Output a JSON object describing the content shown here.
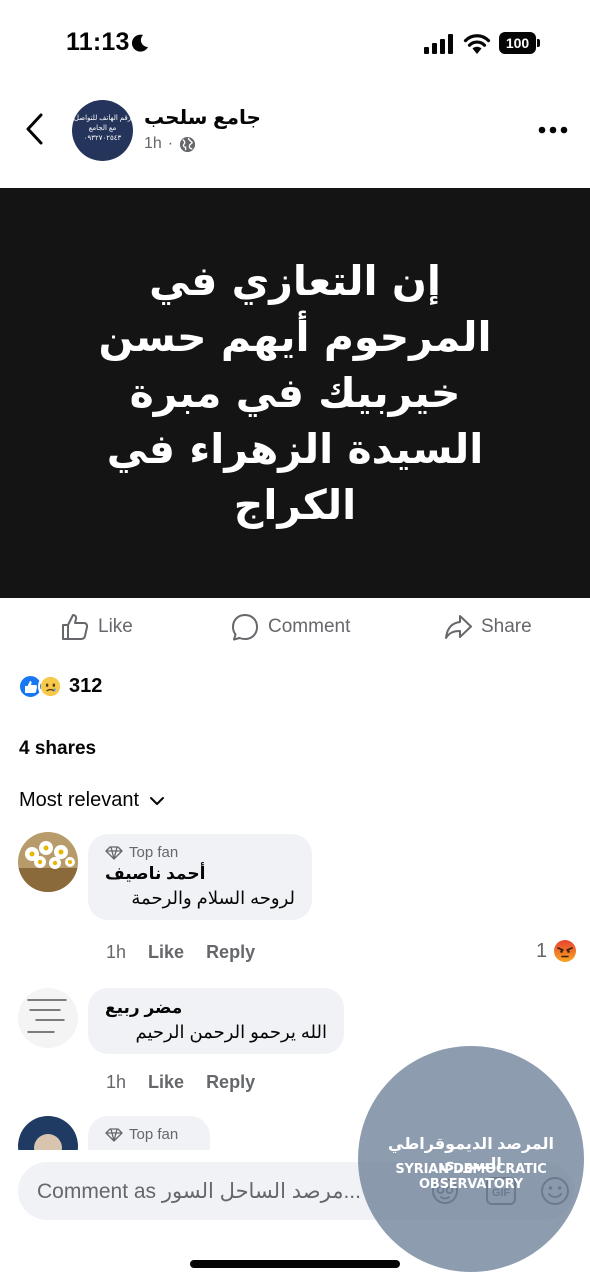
{
  "status_bar": {
    "time": "11:13",
    "battery": "100"
  },
  "post": {
    "page_name": "جامع سلحب",
    "time": "1h",
    "separator": "·",
    "avatar_text": "رقم الهاتف للتواصل مع الجامع ٠٩٣٢٧٠٢٥٤٣",
    "image_text": "إن التعازي في المرحوم أيهم حسن خيربيك في مبرة السيدة الزهراء في الكراج"
  },
  "actions": {
    "like": "Like",
    "comment": "Comment",
    "share": "Share"
  },
  "reactions": {
    "count": "312"
  },
  "shares": "4 shares",
  "sort_label": "Most relevant",
  "comments": [
    {
      "badge": "Top fan",
      "author": "أحمد ناصيف",
      "text": "لروحه السلام والرحمة",
      "time": "1h",
      "like": "Like",
      "reply": "Reply",
      "reaction_count": "1"
    },
    {
      "author": "مضر ربيع",
      "text": "الله يرحمو الرحمن الرحيم",
      "time": "1h",
      "like": "Like",
      "reply": "Reply"
    },
    {
      "badge": "Top fan"
    }
  ],
  "composer": {
    "placeholder": "Comment as مرصد الساحل السور..."
  },
  "watermark": {
    "arabic": "المرصد الديموقراطي السوري",
    "english": "SYRIAN DEMOCRATIC OBSERVATORY"
  },
  "colors": {
    "like_blue": "#1877f2",
    "image_bg": "#141414",
    "bubble_bg": "#f0f2f5",
    "secondary_text": "#65676b"
  }
}
